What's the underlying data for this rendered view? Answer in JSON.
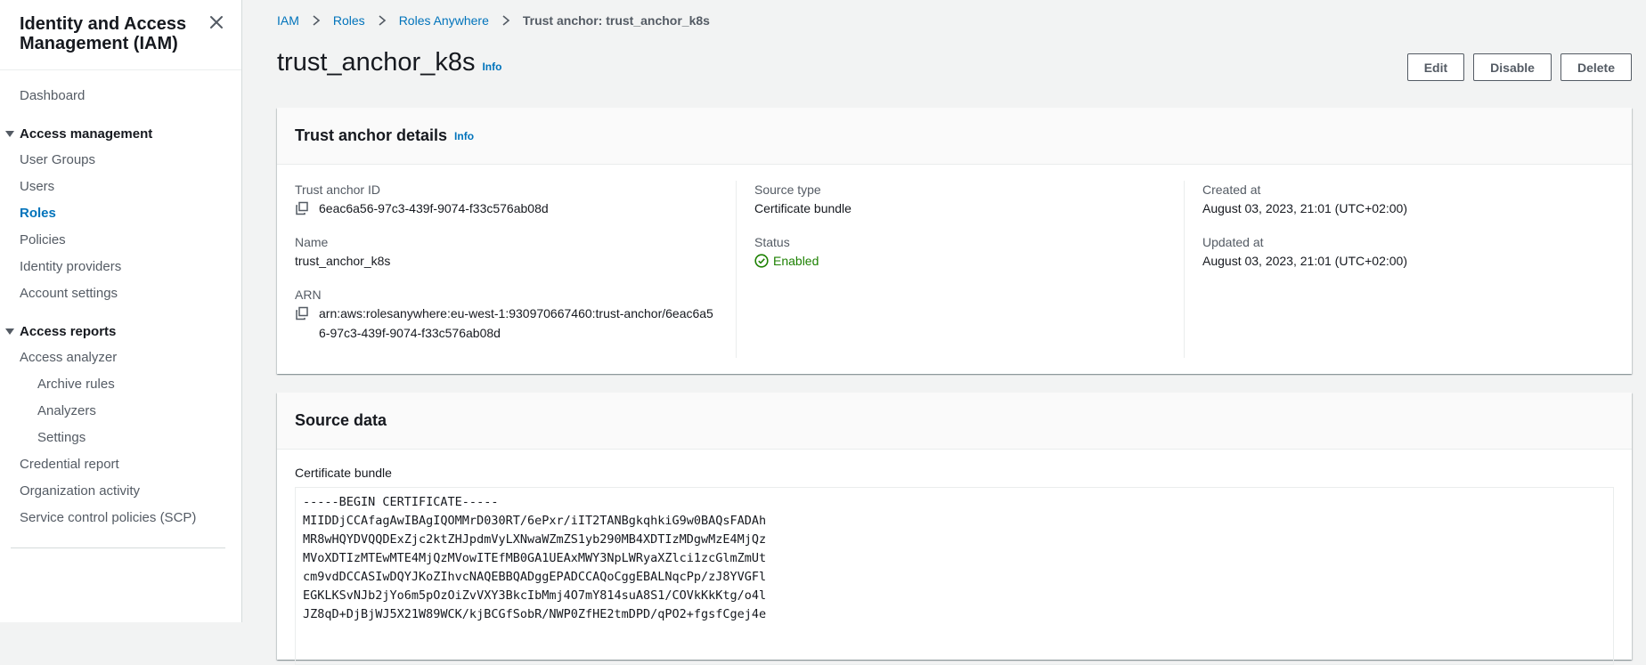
{
  "sidebar": {
    "title": "Identity and Access Management (IAM)",
    "items": {
      "dashboard": "Dashboard",
      "access_management": "Access management",
      "user_groups": "User Groups",
      "users": "Users",
      "roles": "Roles",
      "policies": "Policies",
      "identity_providers": "Identity providers",
      "account_settings": "Account settings",
      "access_reports": "Access reports",
      "access_analyzer": "Access analyzer",
      "archive_rules": "Archive rules",
      "analyzers": "Analyzers",
      "settings": "Settings",
      "credential_report": "Credential report",
      "organization_activity": "Organization activity",
      "scp": "Service control policies (SCP)"
    },
    "active_item": "Roles"
  },
  "breadcrumb": [
    "IAM",
    "Roles",
    "Roles Anywhere",
    "Trust anchor: trust_anchor_k8s"
  ],
  "page": {
    "title": "trust_anchor_k8s",
    "info": "Info"
  },
  "actions": {
    "edit": "Edit",
    "disable": "Disable",
    "delete": "Delete"
  },
  "details": {
    "title": "Trust anchor details",
    "info": "Info",
    "trust_anchor_id_label": "Trust anchor ID",
    "trust_anchor_id": "6eac6a56-97c3-439f-9074-f33c576ab08d",
    "name_label": "Name",
    "name": "trust_anchor_k8s",
    "arn_label": "ARN",
    "arn": "arn:aws:rolesanywhere:eu-west-1:930970667460:trust-anchor/6eac6a56-97c3-439f-9074-f33c576ab08d",
    "source_type_label": "Source type",
    "source_type": "Certificate bundle",
    "status_label": "Status",
    "status": "Enabled",
    "created_label": "Created at",
    "created": "August 03, 2023, 21:01 (UTC+02:00)",
    "updated_label": "Updated at",
    "updated": "August 03, 2023, 21:01 (UTC+02:00)"
  },
  "source": {
    "title": "Source data",
    "bundle_label": "Certificate bundle",
    "lines": [
      "-----BEGIN CERTIFICATE-----",
      "MIIDDjCCAfagAwIBAgIQOMMrD030RT/6ePxr/iIT2TANBgkqhkiG9w0BAQsFADAh",
      "MR8wHQYDVQQDExZjc2ktZHJpdmVyLXNwaWZmZS1yb290MB4XDTIzMDgwMzE4MjQz",
      "MVoXDTIzMTEwMTE4MjQzMVowITEfMB0GA1UEAxMWY3NpLWRyaXZlci1zcGlmZmUt",
      "cm9vdDCCASIwDQYJKoZIhvcNAQEBBQADggEPADCCAQoCggEBALNqcPp/zJ8YVGFl",
      "EGKLKSvNJb2jYo6m5pOzOiZvVXY3BkcIbMmj4O7mY814suA8S1/COVkKkKtg/o4l",
      "JZ8qD+DjBjWJ5X21W89WCK/kjBCGfSobR/NWP0ZfHE2tmDPD/qPO2+fgsfCgej4e"
    ]
  },
  "colors": {
    "link": "#0073bb",
    "success": "#1d8102",
    "background": "#f2f3f3"
  }
}
